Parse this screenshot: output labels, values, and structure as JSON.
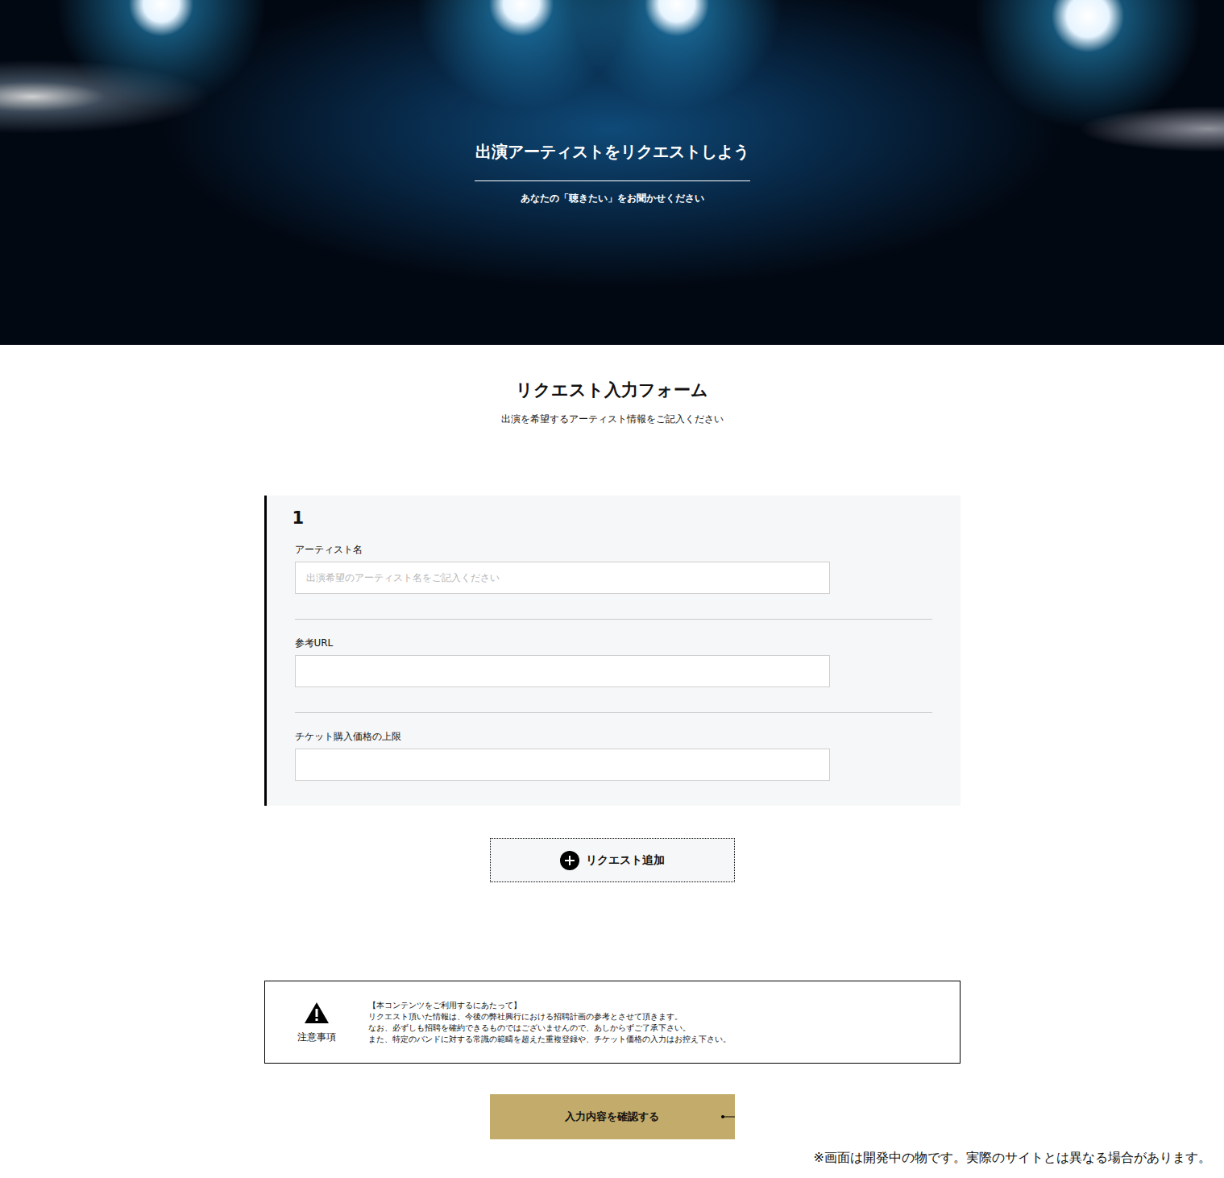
{
  "hero": {
    "title": "出演アーティストをリクエストしよう",
    "subtitle": "あなたの「聴きたい」をお聞かせください"
  },
  "form": {
    "title": "リクエスト入力フォーム",
    "subtitle": "出演を希望するアーティスト情報をご記入ください"
  },
  "requests": [
    {
      "number": "1",
      "fields": [
        {
          "label": "アーティスト名",
          "placeholder": "出演希望のアーティスト名をご記入ください",
          "value": ""
        },
        {
          "label": "参考URL",
          "placeholder": "",
          "value": ""
        },
        {
          "label": "チケット購入価格の上限",
          "placeholder": "",
          "value": ""
        }
      ]
    }
  ],
  "add_button": "リクエスト追加",
  "notice": {
    "label": "注意事項",
    "lines": [
      "【本コンテンツをご利用するにあたって】",
      "リクエスト頂いた情報は、今後の弊社興行における招聘計画の参考とさせて頂きます。",
      "なお、必ずしも招聘を確約できるものではございませんので、あしからずご了承下さい。",
      "また、特定のバンドに対する常識の範疇を超えた重複登録や、チケット価格の入力はお控え下さい。"
    ]
  },
  "confirm_button": "入力内容を確認する",
  "footnote": "※画面は開発中の物です。実際のサイトとは異なる場合があります。"
}
